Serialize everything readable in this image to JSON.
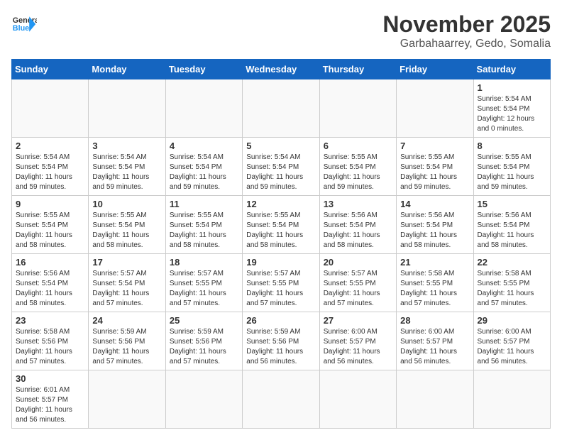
{
  "header": {
    "logo_general": "General",
    "logo_blue": "Blue",
    "month_title": "November 2025",
    "location": "Garbahaarrey, Gedo, Somalia"
  },
  "weekdays": [
    "Sunday",
    "Monday",
    "Tuesday",
    "Wednesday",
    "Thursday",
    "Friday",
    "Saturday"
  ],
  "days": {
    "1": {
      "sunrise": "5:54 AM",
      "sunset": "5:54 PM",
      "daylight": "12 hours and 0 minutes."
    },
    "2": {
      "sunrise": "5:54 AM",
      "sunset": "5:54 PM",
      "daylight": "11 hours and 59 minutes."
    },
    "3": {
      "sunrise": "5:54 AM",
      "sunset": "5:54 PM",
      "daylight": "11 hours and 59 minutes."
    },
    "4": {
      "sunrise": "5:54 AM",
      "sunset": "5:54 PM",
      "daylight": "11 hours and 59 minutes."
    },
    "5": {
      "sunrise": "5:54 AM",
      "sunset": "5:54 PM",
      "daylight": "11 hours and 59 minutes."
    },
    "6": {
      "sunrise": "5:55 AM",
      "sunset": "5:54 PM",
      "daylight": "11 hours and 59 minutes."
    },
    "7": {
      "sunrise": "5:55 AM",
      "sunset": "5:54 PM",
      "daylight": "11 hours and 59 minutes."
    },
    "8": {
      "sunrise": "5:55 AM",
      "sunset": "5:54 PM",
      "daylight": "11 hours and 59 minutes."
    },
    "9": {
      "sunrise": "5:55 AM",
      "sunset": "5:54 PM",
      "daylight": "11 hours and 58 minutes."
    },
    "10": {
      "sunrise": "5:55 AM",
      "sunset": "5:54 PM",
      "daylight": "11 hours and 58 minutes."
    },
    "11": {
      "sunrise": "5:55 AM",
      "sunset": "5:54 PM",
      "daylight": "11 hours and 58 minutes."
    },
    "12": {
      "sunrise": "5:55 AM",
      "sunset": "5:54 PM",
      "daylight": "11 hours and 58 minutes."
    },
    "13": {
      "sunrise": "5:56 AM",
      "sunset": "5:54 PM",
      "daylight": "11 hours and 58 minutes."
    },
    "14": {
      "sunrise": "5:56 AM",
      "sunset": "5:54 PM",
      "daylight": "11 hours and 58 minutes."
    },
    "15": {
      "sunrise": "5:56 AM",
      "sunset": "5:54 PM",
      "daylight": "11 hours and 58 minutes."
    },
    "16": {
      "sunrise": "5:56 AM",
      "sunset": "5:54 PM",
      "daylight": "11 hours and 58 minutes."
    },
    "17": {
      "sunrise": "5:57 AM",
      "sunset": "5:54 PM",
      "daylight": "11 hours and 57 minutes."
    },
    "18": {
      "sunrise": "5:57 AM",
      "sunset": "5:55 PM",
      "daylight": "11 hours and 57 minutes."
    },
    "19": {
      "sunrise": "5:57 AM",
      "sunset": "5:55 PM",
      "daylight": "11 hours and 57 minutes."
    },
    "20": {
      "sunrise": "5:57 AM",
      "sunset": "5:55 PM",
      "daylight": "11 hours and 57 minutes."
    },
    "21": {
      "sunrise": "5:58 AM",
      "sunset": "5:55 PM",
      "daylight": "11 hours and 57 minutes."
    },
    "22": {
      "sunrise": "5:58 AM",
      "sunset": "5:55 PM",
      "daylight": "11 hours and 57 minutes."
    },
    "23": {
      "sunrise": "5:58 AM",
      "sunset": "5:56 PM",
      "daylight": "11 hours and 57 minutes."
    },
    "24": {
      "sunrise": "5:59 AM",
      "sunset": "5:56 PM",
      "daylight": "11 hours and 57 minutes."
    },
    "25": {
      "sunrise": "5:59 AM",
      "sunset": "5:56 PM",
      "daylight": "11 hours and 57 minutes."
    },
    "26": {
      "sunrise": "5:59 AM",
      "sunset": "5:56 PM",
      "daylight": "11 hours and 56 minutes."
    },
    "27": {
      "sunrise": "6:00 AM",
      "sunset": "5:57 PM",
      "daylight": "11 hours and 56 minutes."
    },
    "28": {
      "sunrise": "6:00 AM",
      "sunset": "5:57 PM",
      "daylight": "11 hours and 56 minutes."
    },
    "29": {
      "sunrise": "6:00 AM",
      "sunset": "5:57 PM",
      "daylight": "11 hours and 56 minutes."
    },
    "30": {
      "sunrise": "6:01 AM",
      "sunset": "5:57 PM",
      "daylight": "11 hours and 56 minutes."
    }
  }
}
